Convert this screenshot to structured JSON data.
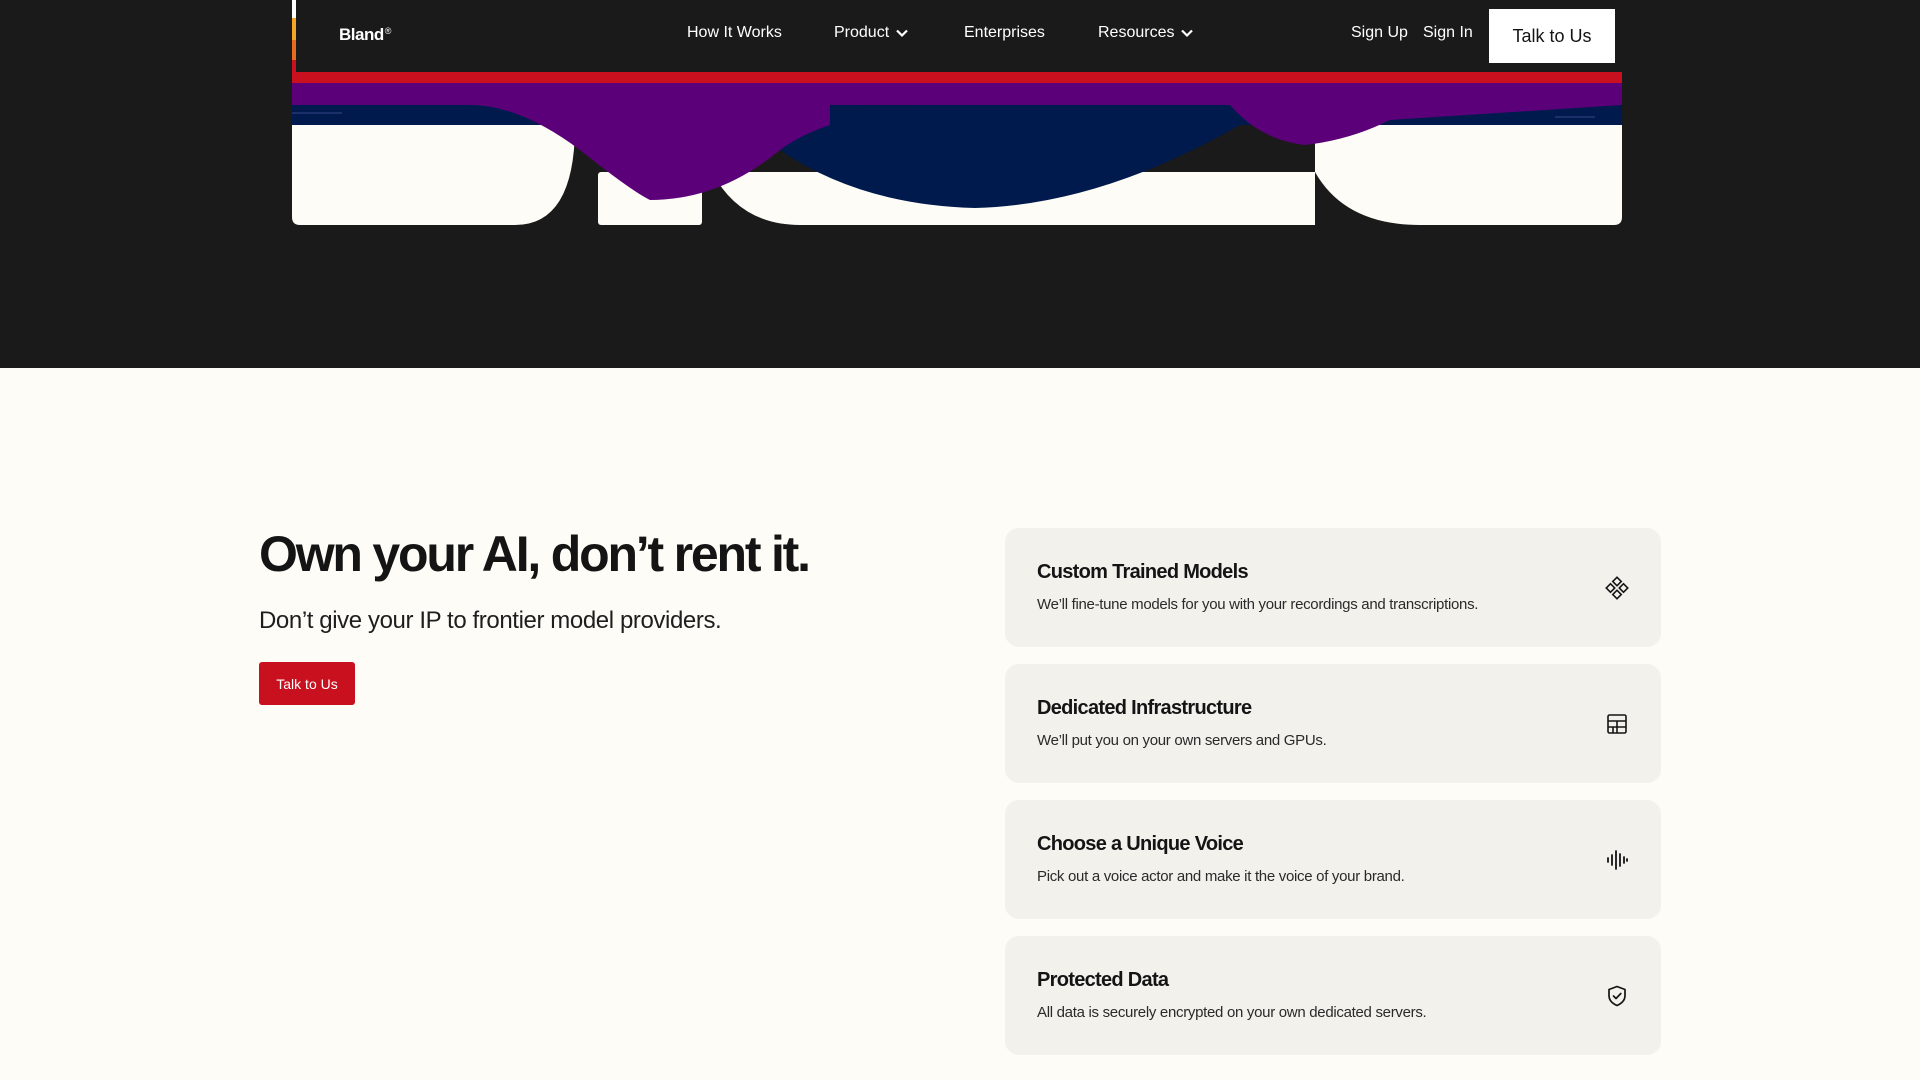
{
  "nav": {
    "logo": "Bland",
    "logo_mark": "®",
    "links": [
      {
        "label": "How It Works"
      },
      {
        "label": "Product",
        "has_dropdown": true
      },
      {
        "label": "Enterprises"
      },
      {
        "label": "Resources",
        "has_dropdown": true
      }
    ],
    "sign_up": "Sign Up",
    "sign_in": "Sign In",
    "talk_button": "Talk to Us"
  },
  "hero": {
    "colors": {
      "background": "#1a1a1a",
      "red": "#c8101e",
      "purple": "#5c007a",
      "navy": "#001a4d",
      "cream": "#fefcf6",
      "orange": "#f5a623"
    }
  },
  "main": {
    "headline": "Own your AI, don’t rent it.",
    "subhead": "Don’t give your IP to frontier model providers.",
    "cta": "Talk to Us",
    "cta_color": "#c8101e"
  },
  "features": [
    {
      "title": "Custom Trained Models",
      "description": "We’ll fine-tune models for you with your recordings and transcriptions.",
      "icon": "nodes-icon"
    },
    {
      "title": "Dedicated Infrastructure",
      "description": "We’ll put you on your own servers and GPUs.",
      "icon": "server-grid-icon"
    },
    {
      "title": "Choose a Unique Voice",
      "description": "Pick out a voice actor and make it the voice of your brand.",
      "icon": "waveform-icon"
    },
    {
      "title": "Protected Data",
      "description": "All data is securely encrypted on your own dedicated servers.",
      "icon": "shield-check-icon"
    }
  ]
}
